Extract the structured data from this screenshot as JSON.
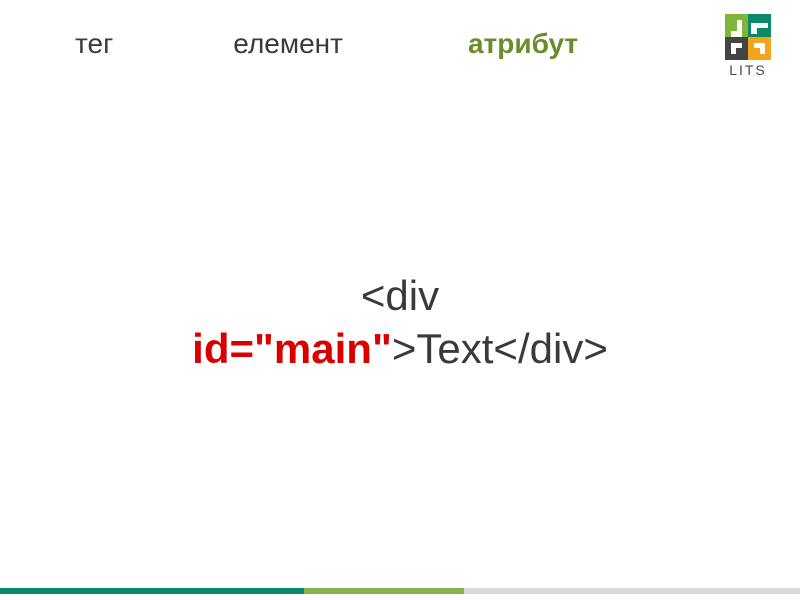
{
  "header": {
    "tag_label": "тег",
    "element_label": "елемент",
    "attribute_label": "атрибут"
  },
  "logo": {
    "text": "LITS"
  },
  "code": {
    "part1": "<div",
    "attr": "id=\"main\"",
    "part2": ">Text</div>"
  }
}
